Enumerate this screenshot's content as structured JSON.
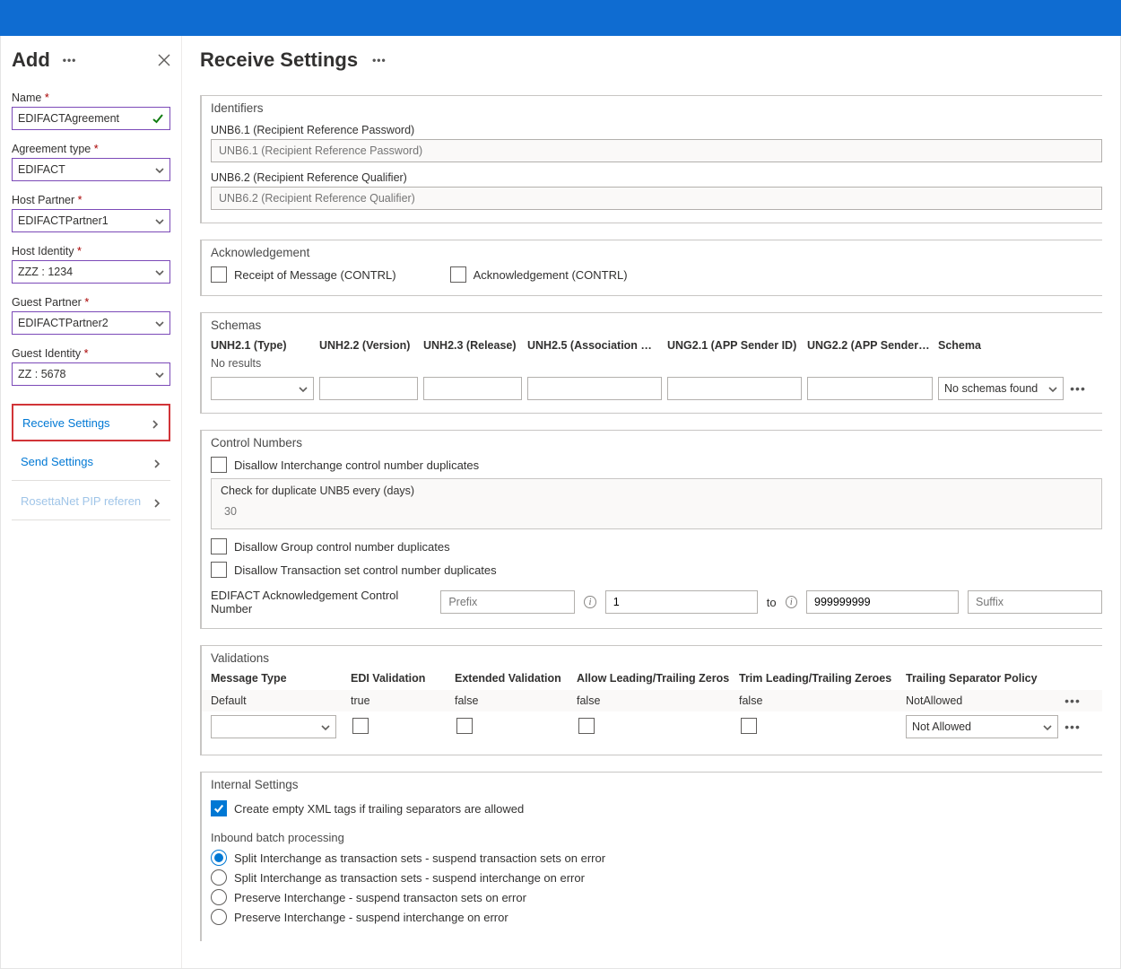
{
  "sidebar": {
    "title": "Add",
    "fields": {
      "name_label": "Name",
      "name_value": "EDIFACTAgreement",
      "agreement_type_label": "Agreement type",
      "agreement_type_value": "EDIFACT",
      "host_partner_label": "Host Partner",
      "host_partner_value": "EDIFACTPartner1",
      "host_identity_label": "Host Identity",
      "host_identity_value": "ZZZ : 1234",
      "guest_partner_label": "Guest Partner",
      "guest_partner_value": "EDIFACTPartner2",
      "guest_identity_label": "Guest Identity",
      "guest_identity_value": "ZZ : 5678"
    },
    "nav": {
      "receive": "Receive Settings",
      "send": "Send Settings",
      "rosetta": "RosettaNet PIP referen"
    }
  },
  "main": {
    "title": "Receive Settings",
    "identifiers": {
      "section": "Identifiers",
      "unb61_label": "UNB6.1 (Recipient Reference Password)",
      "unb61_placeholder": "UNB6.1 (Recipient Reference Password)",
      "unb62_label": "UNB6.2 (Recipient Reference Qualifier)",
      "unb62_placeholder": "UNB6.2 (Recipient Reference Qualifier)"
    },
    "acknowledgement": {
      "section": "Acknowledgement",
      "receipt": "Receipt of Message (CONTRL)",
      "ack": "Acknowledgement (CONTRL)"
    },
    "schemas": {
      "section": "Schemas",
      "headers": [
        "UNH2.1 (Type)",
        "UNH2.2 (Version)",
        "UNH2.3 (Release)",
        "UNH2.5 (Association …",
        "UNG2.1 (APP Sender ID)",
        "UNG2.2 (APP Sender…",
        "Schema"
      ],
      "no_results": "No results",
      "no_schemas": "No schemas found"
    },
    "control_numbers": {
      "section": "Control Numbers",
      "disallow_interchange": "Disallow Interchange control number duplicates",
      "check_dup_label": "Check for duplicate UNB5 every (days)",
      "check_dup_value": "30",
      "disallow_group": "Disallow Group control number duplicates",
      "disallow_txn": "Disallow Transaction set control number duplicates",
      "acn_label": "EDIFACT Acknowledgement Control Number",
      "prefix_ph": "Prefix",
      "from_value": "1",
      "to_label": "to",
      "to_value": "999999999",
      "suffix_ph": "Suffix"
    },
    "validations": {
      "section": "Validations",
      "headers": [
        "Message Type",
        "EDI Validation",
        "Extended Validation",
        "Allow Leading/Trailing Zeros",
        "Trim Leading/Trailing Zeroes",
        "Trailing Separator Policy"
      ],
      "row1": {
        "msg_type": "Default",
        "edi": "true",
        "ext": "false",
        "allow": "false",
        "trim": "false",
        "policy": "NotAllowed"
      },
      "not_allowed": "Not Allowed"
    },
    "internal": {
      "section": "Internal Settings",
      "create_empty": "Create empty XML tags if trailing separators are allowed",
      "batch_label": "Inbound batch processing",
      "opt1": "Split Interchange as transaction sets - suspend transaction sets on error",
      "opt2": "Split Interchange as transaction sets - suspend interchange on error",
      "opt3": "Preserve Interchange - suspend transacton sets on error",
      "opt4": "Preserve Interchange - suspend interchange on error"
    }
  }
}
